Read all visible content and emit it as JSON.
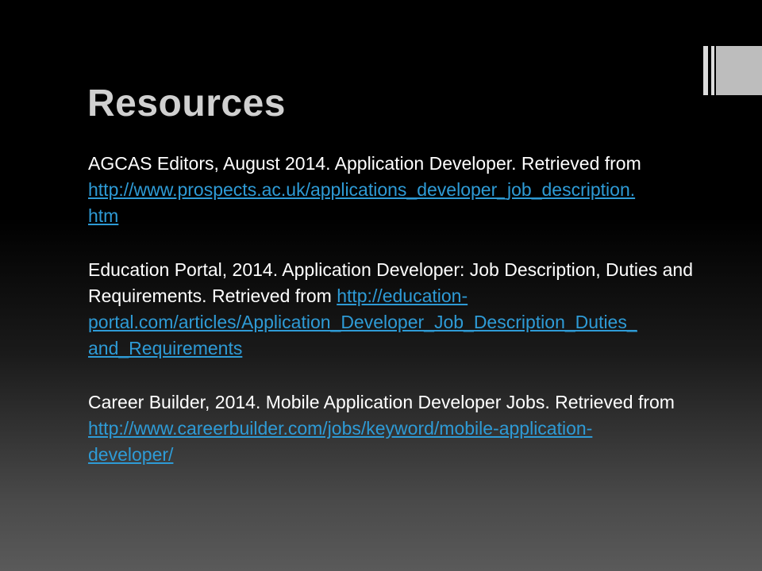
{
  "slide": {
    "title": "Resources",
    "references": [
      {
        "text": "AGCAS Editors, August 2014. Application Developer. Retrieved from",
        "url_lines": [
          "http://www.prospects.ac.uk/applications_developer_job_description.",
          "htm"
        ]
      },
      {
        "text": "Education Portal, 2014. Application Developer: Job Description, Duties and Requirements. Retrieved from",
        "url_lines": [
          "http://education-",
          "portal.com/articles/Application_Developer_Job_Description_Duties_",
          "and_Requirements"
        ]
      },
      {
        "text": "Career Builder, 2014. Mobile Application Developer Jobs. Retrieved from",
        "url_lines": [
          "http://www.careerbuilder.com/jobs/keyword/mobile-application-",
          "developer/"
        ]
      }
    ]
  },
  "colors": {
    "link": "#2e9bd6",
    "text": "#ffffff",
    "title": "#d0d0d0",
    "background_top": "#000000",
    "background_bottom": "#5a5a5a"
  }
}
